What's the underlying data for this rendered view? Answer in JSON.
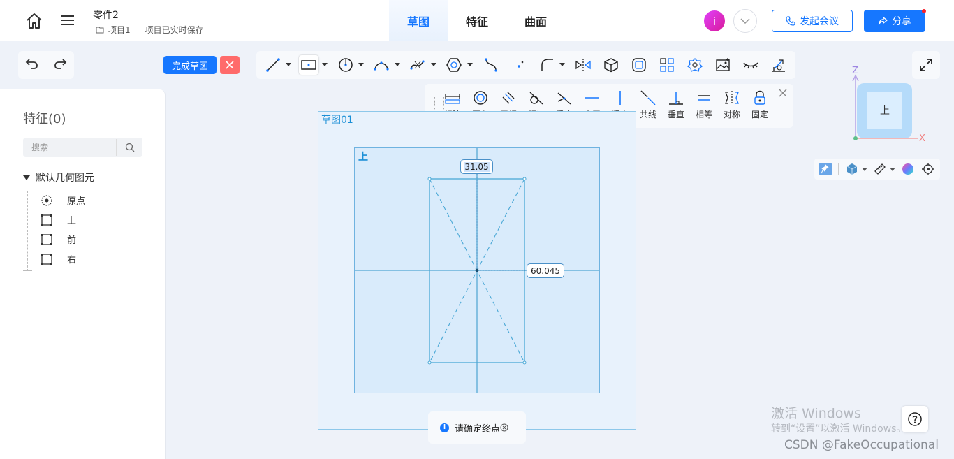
{
  "header": {
    "doc_title": "零件2",
    "breadcrumb_project": "项目1",
    "save_status": "项目已实时保存",
    "tabs": [
      {
        "label": "草图"
      },
      {
        "label": "特征"
      },
      {
        "label": "曲面"
      }
    ],
    "avatar_letter": "i",
    "meeting_label": "发起会议",
    "share_label": "分享"
  },
  "sketch_actions": {
    "finish_label": "完成草图"
  },
  "toolbar": {
    "tools": [
      "line-icon",
      "rectangle-icon",
      "circle-icon",
      "arc-icon",
      "spline-icon",
      "polygon-icon",
      "curve-icon",
      "point-icon",
      "fillet-icon",
      "mirror-icon",
      "cube-icon",
      "offset-icon",
      "pattern-icon",
      "gear-icon",
      "image-icon",
      "hide-icon",
      "measure-icon"
    ]
  },
  "constraints": {
    "items": [
      {
        "label": "标注"
      },
      {
        "label": "同心"
      },
      {
        "label": "平行"
      },
      {
        "label": "相切"
      },
      {
        "label": "重合"
      },
      {
        "label": "水平"
      },
      {
        "label": "竖直"
      },
      {
        "label": "共线"
      },
      {
        "label": "垂直"
      },
      {
        "label": "相等"
      },
      {
        "label": "对称"
      },
      {
        "label": "固定"
      }
    ]
  },
  "feature_panel": {
    "title": "特征(0)",
    "search_placeholder": "搜索",
    "tree_root": "默认几何图元",
    "tree_items": [
      {
        "label": "原点"
      },
      {
        "label": "上"
      },
      {
        "label": "前"
      },
      {
        "label": "右"
      }
    ]
  },
  "canvas": {
    "sketch_label": "草图01",
    "plane_label": "上",
    "dimension_width": "31.05",
    "dimension_height": "60.045"
  },
  "hint": {
    "text": "请确定终点"
  },
  "viewcube": {
    "face_label": "上",
    "axis_x": "X",
    "axis_z": "Z"
  },
  "watermark": {
    "line1": "激活 Windows",
    "line2": "转到“设置”以激活 Windows。",
    "line3": "CSDN @FakeOccupational"
  },
  "colors": {
    "accent": "#1677ff",
    "cancel": "#ff6b6b",
    "sketch_line": "#4aa8d6"
  }
}
